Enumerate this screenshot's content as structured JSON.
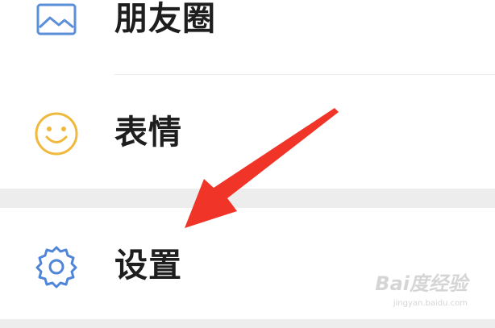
{
  "menu": {
    "items": [
      {
        "label": "朋友圈",
        "icon": "image-icon",
        "icon_color": "#5b8fd8"
      },
      {
        "label": "表情",
        "icon": "smiley-icon",
        "icon_color": "#f0b83c"
      },
      {
        "label": "设置",
        "icon": "gear-icon",
        "icon_color": "#4f86d9"
      }
    ]
  },
  "annotation": {
    "arrow_color": "#f03428"
  },
  "watermark": {
    "logo": "Bai度经验",
    "url": "jingyan.baidu.com"
  }
}
